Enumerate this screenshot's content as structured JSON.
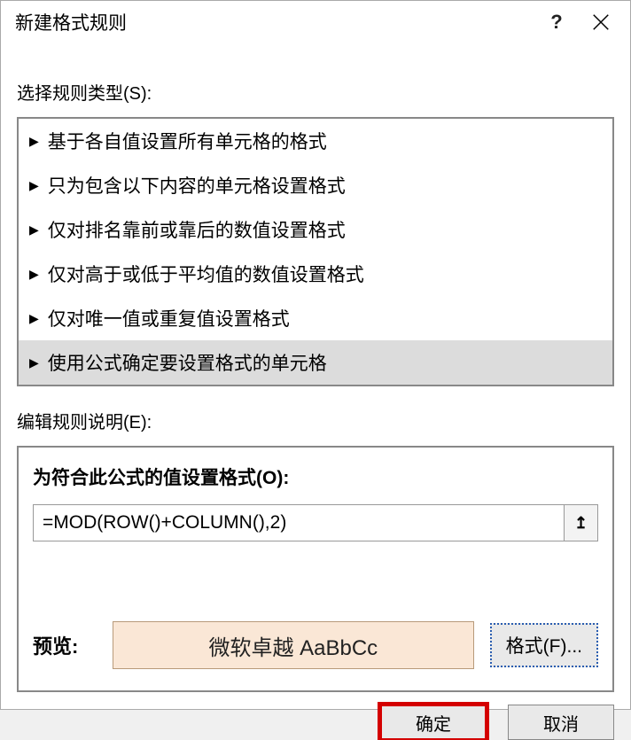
{
  "title": "新建格式规则",
  "help_symbol": "?",
  "section_select_label": "选择规则类型(S):",
  "rules": [
    "基于各自值设置所有单元格的格式",
    "只为包含以下内容的单元格设置格式",
    "仅对排名靠前或靠后的数值设置格式",
    "仅对高于或低于平均值的数值设置格式",
    "仅对唯一值或重复值设置格式",
    "使用公式确定要设置格式的单元格"
  ],
  "section_edit_label": "编辑规则说明(E):",
  "edit_heading": "为符合此公式的值设置格式(O):",
  "formula_value": "=MOD(ROW()+COLUMN(),2)",
  "collapse_symbol": "↥",
  "preview_label": "预览:",
  "preview_sample_text": "微软卓越 AaBbCc",
  "format_button_label": "格式(F)...",
  "ok_label": "确定",
  "cancel_label": "取消"
}
